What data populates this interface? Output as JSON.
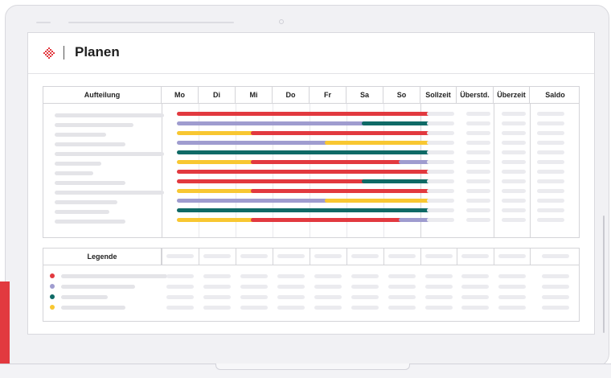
{
  "app": {
    "title": "Planen"
  },
  "plan_table": {
    "headers": [
      "Aufteilung",
      "Mo",
      "Di",
      "Mi",
      "Do",
      "Fr",
      "Sa",
      "So",
      "Sollzeit",
      "Überstd.",
      "Überzeit",
      "Saldo"
    ]
  },
  "legend_table": {
    "header": "Legende"
  },
  "colors": {
    "red": "#e2393f",
    "purple": "#9f9ccf",
    "teal": "#0f6a66",
    "yellow": "#f8c731",
    "placeholder": "#e4e4e8"
  }
}
